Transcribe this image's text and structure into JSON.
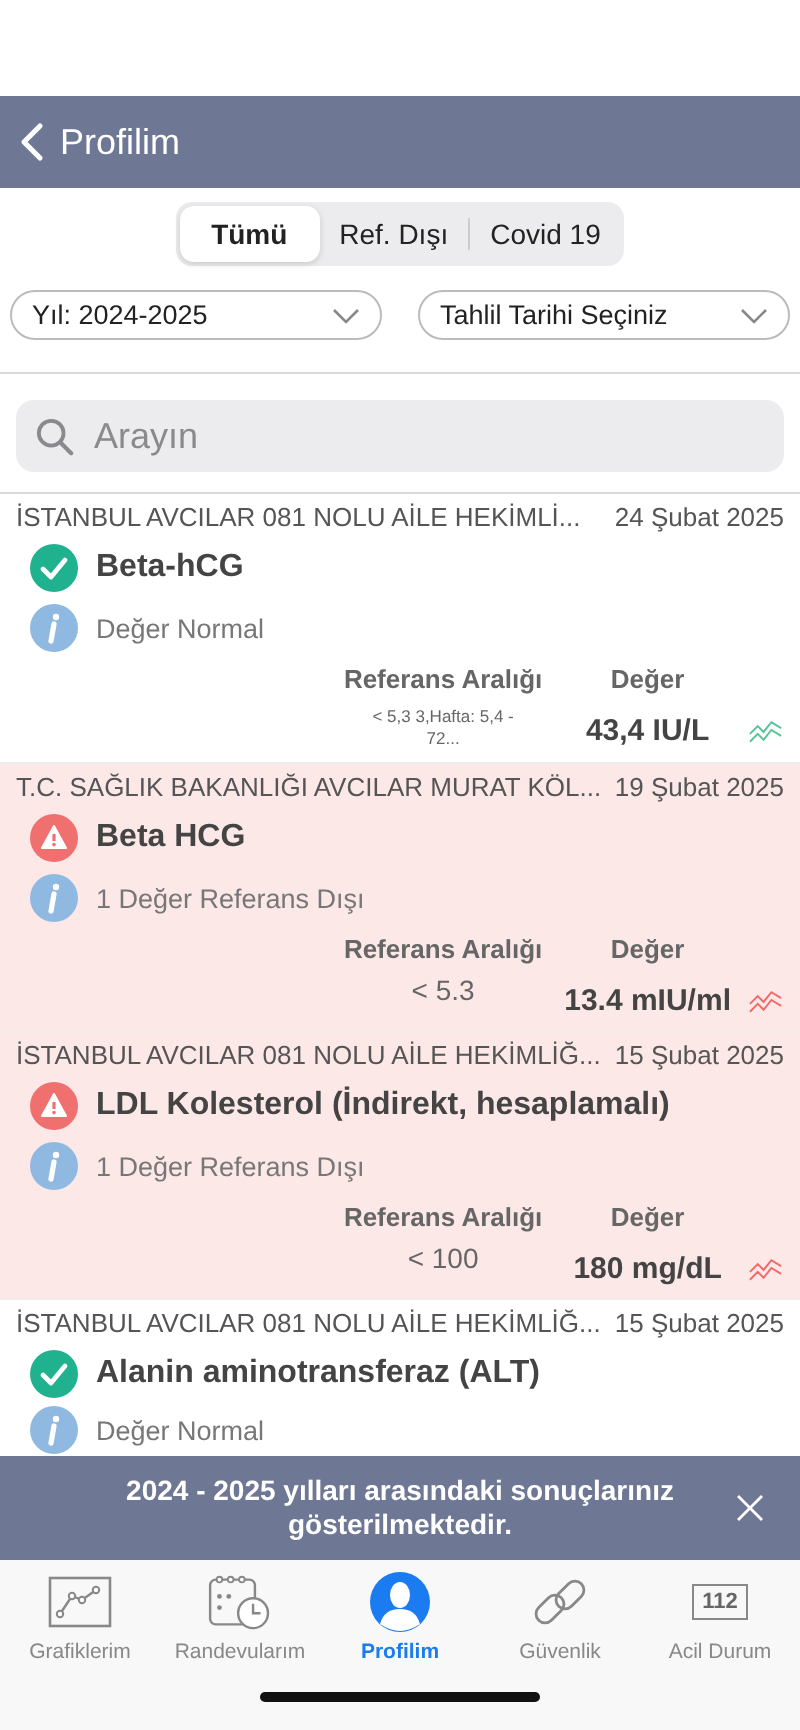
{
  "header": {
    "back_label": "Profilim"
  },
  "segments": [
    {
      "label": "Tümü",
      "selected": true
    },
    {
      "label": "Ref. Dışı",
      "selected": false
    },
    {
      "label": "Covid 19",
      "selected": false
    }
  ],
  "filters": [
    {
      "value": "Yıl: 2024-2025"
    },
    {
      "value": "Tahlil Tarihi Seçiniz"
    }
  ],
  "search": {
    "placeholder": "Arayın"
  },
  "results": [
    {
      "source": "İSTANBUL AVCILAR 081 NOLU AİLE HEKİMLİ...",
      "date": "24 Şubat 2025",
      "test": "Beta-hCG",
      "out_of_range": false,
      "note": "Değer Normal",
      "reference_label": "Referans Aralığı",
      "value_label": "Değer",
      "reference": "< 5,3  3,Hafta: 5,4 - 72...",
      "reference_wrapped": true,
      "value": "43,4 IU/L"
    },
    {
      "source": "T.C. SAĞLIK BAKANLIĞI AVCILAR MURAT KÖL...",
      "date": "19 Şubat 2025",
      "test": "Beta HCG",
      "out_of_range": true,
      "note": "1 Değer Referans Dışı",
      "reference_label": "Referans Aralığı",
      "value_label": "Değer",
      "reference": "< 5.3",
      "reference_wrapped": false,
      "value": "13.4 mIU/ml"
    },
    {
      "source": "İSTANBUL AVCILAR 081 NOLU AİLE HEKİMLİĞ...",
      "date": "15 Şubat 2025",
      "test": "LDL Kolesterol (İndirekt, hesaplamalı)",
      "out_of_range": true,
      "note": "1 Değer Referans Dışı",
      "reference_label": "Referans Aralığı",
      "value_label": "Değer",
      "reference": "< 100",
      "reference_wrapped": false,
      "value": "180 mg/dL"
    },
    {
      "source": "İSTANBUL AVCILAR 081 NOLU AİLE HEKİMLİĞ...",
      "date": "15 Şubat 2025",
      "test": "Alanin aminotransferaz (ALT)",
      "out_of_range": false,
      "note": "Değer Normal"
    }
  ],
  "banner": {
    "message": "2024 - 2025 yılları arasındaki sonuçlarınız gösterilmektedir."
  },
  "tab_bar": [
    {
      "kind": "chart",
      "label": "Grafiklerim",
      "selected": false
    },
    {
      "kind": "calendar",
      "label": "Randevularım",
      "selected": false
    },
    {
      "kind": "profile",
      "label": "Profilim",
      "selected": true
    },
    {
      "kind": "link",
      "label": "Güvenlik",
      "selected": false
    },
    {
      "kind": "emergency",
      "label": "Acil Durum",
      "badge": "112",
      "selected": false
    }
  ]
}
